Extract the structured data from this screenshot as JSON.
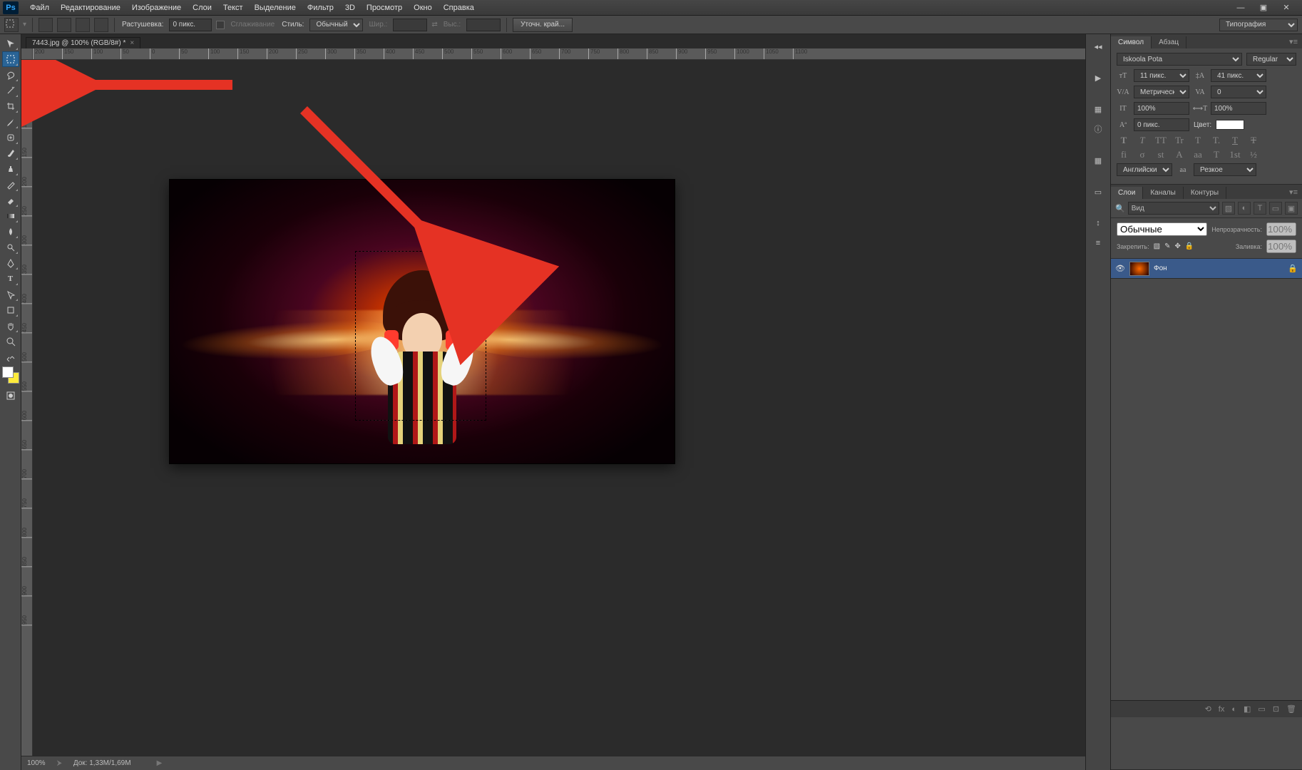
{
  "app": {
    "logo": "Ps"
  },
  "window_buttons": {
    "min": "—",
    "max": "▣",
    "close": "✕"
  },
  "menu": [
    "Файл",
    "Редактирование",
    "Изображение",
    "Слои",
    "Текст",
    "Выделение",
    "Фильтр",
    "3D",
    "Просмотр",
    "Окно",
    "Справка"
  ],
  "workspace_picker": "Типография",
  "options": {
    "feather_label": "Растушевка:",
    "feather_value": "0 пикс.",
    "antialias_label": "Сглаживание",
    "style_label": "Стиль:",
    "style_value": "Обычный",
    "width_label": "Шир.:",
    "height_label": "Выс.:",
    "refine_edge": "Уточн. край..."
  },
  "doc_tab": {
    "title": "7443.jpg @ 100% (RGB/8#) *",
    "close": "×"
  },
  "ruler_values": [
    "200",
    "150",
    "100",
    "50",
    "0",
    "50",
    "100",
    "150",
    "200",
    "250",
    "300",
    "350",
    "400",
    "450",
    "500",
    "550",
    "600",
    "650",
    "700",
    "750",
    "800",
    "850",
    "900",
    "950",
    "1000",
    "1050",
    "1100"
  ],
  "vruler_values": [
    "50",
    "100",
    "150",
    "200",
    "250",
    "300",
    "350",
    "400",
    "450",
    "500",
    "550",
    "600",
    "650",
    "700",
    "750",
    "800",
    "850",
    "900",
    "950"
  ],
  "character_panel": {
    "tabs": [
      "Символ",
      "Абзац"
    ],
    "font": "Iskoola Pota",
    "style": "Regular",
    "size": "11 пикс.",
    "leading": "41 пикс.",
    "kerning": "Метрический",
    "tracking": "0",
    "scale_x": "100%",
    "scale_y": "100%",
    "baseline": "0 пикс.",
    "color_label": "Цвет:",
    "type_row1": [
      "T",
      "T",
      "TT",
      "Tr",
      "T",
      "T.",
      "T",
      "Ŧ"
    ],
    "type_row2": [
      "fi",
      "σ",
      "st",
      "A",
      "aa",
      "T",
      "1st",
      "½"
    ],
    "lang": "Английский...",
    "aa": "Резкое",
    "aa_toggle": "aa"
  },
  "layers_panel": {
    "tabs": [
      "Слои",
      "Каналы",
      "Контуры"
    ],
    "filter_kind": "Вид",
    "mode": "Обычные",
    "opacity_label": "Непрозрачность:",
    "opacity_value": "100%",
    "lock_label": "Закрепить:",
    "fill_label": "Заливка:",
    "fill_value": "100%",
    "layer_name": "Фон",
    "footer_icons": [
      "⟲",
      "fx",
      "◐",
      "◧",
      "▭",
      "⊡",
      "🗑"
    ]
  },
  "status": {
    "zoom": "100%",
    "doc_label": "Док:",
    "doc_value": "1,33M/1,69M"
  },
  "tool_icons": [
    "✥",
    "▭",
    "◇",
    "✄",
    "✎",
    "✂",
    "✎",
    "⌫",
    "✎",
    "⟋",
    "✎",
    "⌂",
    "◧",
    "≋",
    "⍓",
    "◌",
    "✎",
    "T",
    "▷",
    "✋",
    "🔍"
  ],
  "strip_icons": [
    "◂◂",
    "▶",
    "▦",
    "ⓘ",
    "▦",
    "▭",
    "↕",
    "≡",
    "✎"
  ]
}
